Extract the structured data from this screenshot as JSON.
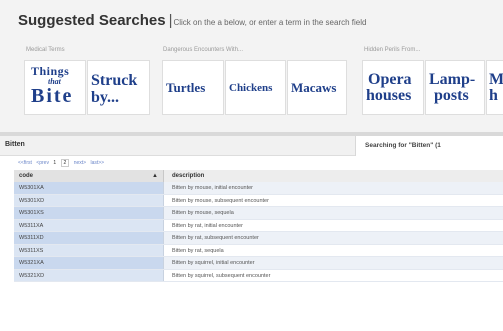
{
  "header": {
    "title": "Suggested Searches",
    "separator": "|",
    "hint": "Click on the a below, or enter a term in the search field",
    "groups": [
      {
        "label": "Medical Terms"
      },
      {
        "label": "Dangerous Encounters With..."
      },
      {
        "label": "Hidden Perils From..."
      }
    ],
    "tiles": [
      {
        "line1": "Things",
        "line2": "that",
        "line3": "Bite"
      },
      {
        "line1": "Struck",
        "line2": "by..."
      },
      {
        "line1": "Turtles"
      },
      {
        "line1": "Chickens"
      },
      {
        "line1": "Macaws"
      },
      {
        "line1": "Opera",
        "line2": "houses"
      },
      {
        "line1": "Lamp-",
        "line2": "posts"
      },
      {
        "line1": "M",
        "line2": "h"
      }
    ]
  },
  "results_bar": {
    "term": "Bitten",
    "searching_label": "Searching for \"Bitten\" (1"
  },
  "pager": {
    "first": "<<first",
    "prev": "<prev",
    "page1": "1",
    "page2": "2",
    "next": "next>",
    "last": "last>>"
  },
  "grid": {
    "columns": {
      "code": "code",
      "description": "description"
    },
    "rows": [
      {
        "code": "W5301XA",
        "description": "Bitten by mouse, initial encounter"
      },
      {
        "code": "W5301XD",
        "description": "Bitten by mouse, subsequent encounter"
      },
      {
        "code": "W5301XS",
        "description": "Bitten by mouse, sequela"
      },
      {
        "code": "W5311XA",
        "description": "Bitten by rat, initial encounter"
      },
      {
        "code": "W5311XD",
        "description": "Bitten by rat, subsequent encounter"
      },
      {
        "code": "W5311XS",
        "description": "Bitten by rat, sequela"
      },
      {
        "code": "W5321XA",
        "description": "Bitten by squirrel, initial encounter"
      },
      {
        "code": "W5321XD",
        "description": "Bitten by squirrel, subsequent encounter"
      }
    ]
  },
  "colors": {
    "header_bg": "#f3f3f3",
    "tile_text": "#1f3f8a",
    "pager_link": "#6b86c8",
    "code_cell_odd": "#c9d8ee",
    "code_cell_even": "#dbe5f3"
  },
  "icons": {
    "sort": "sort-triangle-icon"
  }
}
